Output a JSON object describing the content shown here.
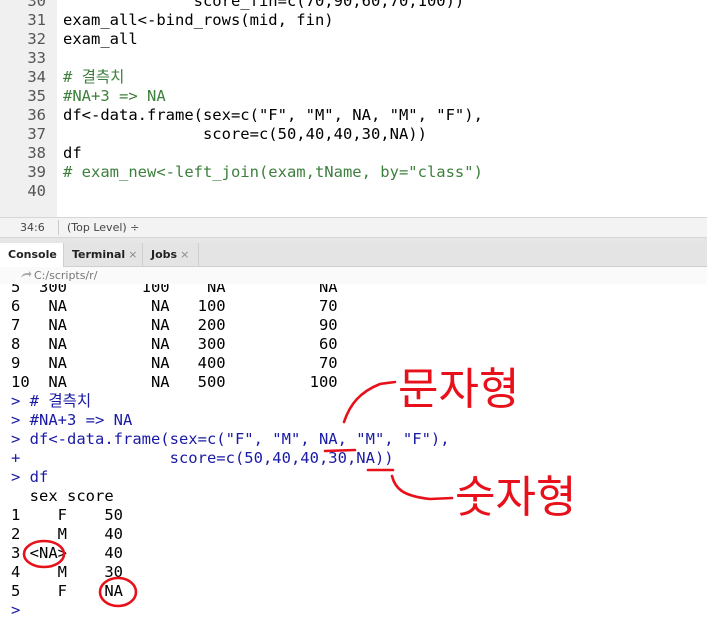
{
  "editor": {
    "lines": [
      {
        "num": "30",
        "code": "              score_fin=c(70,90,60,70,100))"
      },
      {
        "num": "31",
        "code": "exam_all<-bind_rows(mid, fin)"
      },
      {
        "num": "32",
        "code": "exam_all"
      },
      {
        "num": "33",
        "code": ""
      },
      {
        "num": "34",
        "code": "# 결측치"
      },
      {
        "num": "35",
        "code": "#NA+3 => NA"
      },
      {
        "num": "36",
        "code": "df<-data.frame(sex=c(\"F\", \"M\", NA, \"M\", \"F\"),"
      },
      {
        "num": "37",
        "code": "               score=c(50,40,40,30,NA))"
      },
      {
        "num": "38",
        "code": "df"
      },
      {
        "num": "39",
        "code": "# exam_new<-left_join(exam,tName, by=\"class\")"
      },
      {
        "num": "40",
        "code": ""
      }
    ]
  },
  "statusbar": {
    "position": "34:6",
    "level": "(Top Level) ÷"
  },
  "tabs": {
    "console": "Console",
    "terminal": "Terminal",
    "jobs": "Jobs",
    "close": "×"
  },
  "console_path": "C:/scripts/r/",
  "console": {
    "lines": [
      {
        "text": "5  300        100    NA          NA",
        "kind": "out"
      },
      {
        "text": "6   NA         NA   100          70",
        "kind": "out"
      },
      {
        "text": "7   NA         NA   200          90",
        "kind": "out"
      },
      {
        "text": "8   NA         NA   300          60",
        "kind": "out"
      },
      {
        "text": "9   NA         NA   400          70",
        "kind": "out"
      },
      {
        "text": "10  NA         NA   500         100",
        "kind": "out"
      },
      {
        "text": "> # 결측치",
        "kind": "in"
      },
      {
        "text": "> #NA+3 => NA",
        "kind": "in"
      },
      {
        "text": "> df<-data.frame(sex=c(\"F\", \"M\", NA, \"M\", \"F\"),",
        "kind": "in"
      },
      {
        "text": "+                score=c(50,40,40,30,NA))",
        "kind": "in"
      },
      {
        "text": "> df",
        "kind": "in"
      },
      {
        "text": "  sex score",
        "kind": "out"
      },
      {
        "text": "1    F    50",
        "kind": "out"
      },
      {
        "text": "2    M    40",
        "kind": "out"
      },
      {
        "text": "3 <NA>    40",
        "kind": "out"
      },
      {
        "text": "4    M    30",
        "kind": "out"
      },
      {
        "text": "5    F    NA",
        "kind": "out"
      },
      {
        "text": ">",
        "kind": "in"
      }
    ]
  },
  "annotations": {
    "label_char": "문자형",
    "label_num": "숫자형"
  }
}
